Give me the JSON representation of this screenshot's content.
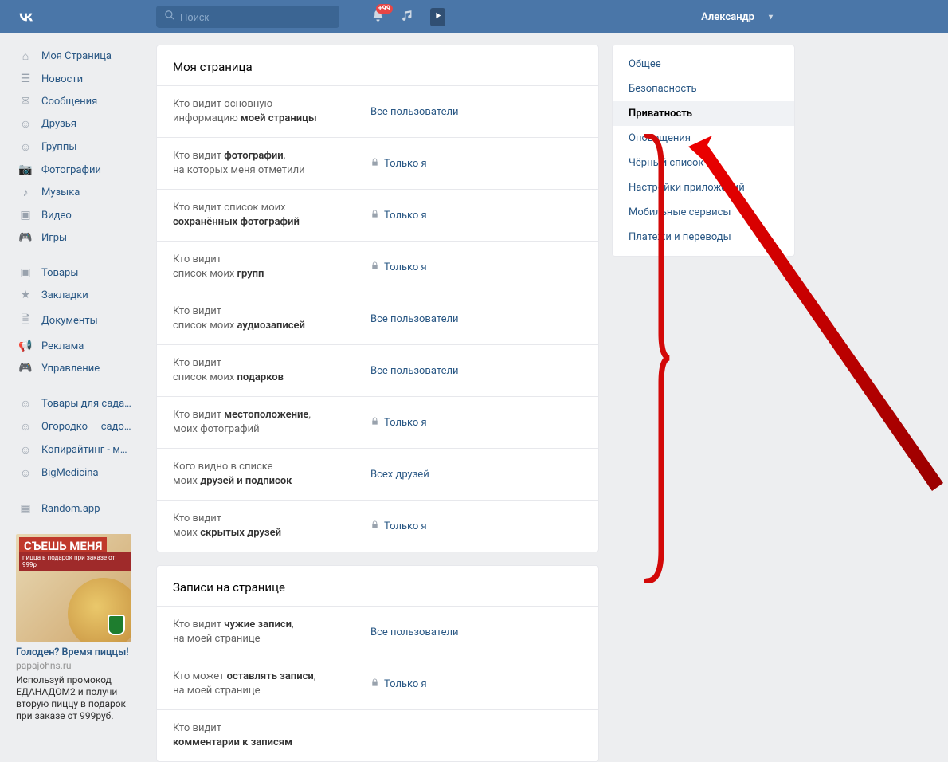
{
  "header": {
    "search_placeholder": "Поиск",
    "notif_badge": "+99",
    "username": "Александр"
  },
  "leftnav": {
    "items_a": [
      {
        "icon": "⌂",
        "label": "Моя Страница"
      },
      {
        "icon": "☰",
        "label": "Новости"
      },
      {
        "icon": "✉",
        "label": "Сообщения"
      },
      {
        "icon": "☺",
        "label": "Друзья"
      },
      {
        "icon": "☺",
        "label": "Группы"
      },
      {
        "icon": "📷",
        "label": "Фотографии"
      },
      {
        "icon": "♪",
        "label": "Музыка"
      },
      {
        "icon": "▣",
        "label": "Видео"
      },
      {
        "icon": "🎮",
        "label": "Игры"
      }
    ],
    "items_b": [
      {
        "icon": "▣",
        "label": "Товары"
      },
      {
        "icon": "★",
        "label": "Закладки"
      },
      {
        "icon": "🗎",
        "label": "Документы"
      },
      {
        "icon": "📢",
        "label": "Реклама"
      },
      {
        "icon": "🎮",
        "label": "Управление"
      }
    ],
    "items_c": [
      {
        "icon": "☺",
        "label": "Товары для сада…"
      },
      {
        "icon": "☺",
        "label": "Огородко — садо…"
      },
      {
        "icon": "☺",
        "label": "Копирайтинг - м…"
      },
      {
        "icon": "☺",
        "label": "BigMedicina"
      }
    ],
    "items_d": [
      {
        "icon": "▦",
        "label": "Random.app"
      }
    ]
  },
  "ad": {
    "red_label": "СЪЕШЬ МЕНЯ",
    "sub": "пицца в подарок при заказе от 999р",
    "title": "Голоден? Время пиццы!",
    "domain": "papajohns.ru",
    "desc": "Используй промокод ЕДАНАДОМ2 и получи вторую пиццу в подарок при заказе от 999руб."
  },
  "section1": {
    "title": "Моя страница",
    "rows": [
      {
        "l1": "Кто видит основную",
        "l2": "информацию ",
        "lb": "моей страницы",
        "value": "Все пользователи",
        "lock": false
      },
      {
        "l1": "Кто видит ",
        "lb1": "фотографии",
        "l2": "на которых меня отметили",
        "value": "Только я",
        "lock": true
      },
      {
        "l1": "Кто видит список моих",
        "l2": "",
        "lb": "сохранённых фотографий",
        "value": "Только я",
        "lock": true
      },
      {
        "l1": "Кто видит",
        "l2": "список моих ",
        "lb": "групп",
        "value": "Только я",
        "lock": true
      },
      {
        "l1": "Кто видит",
        "l2": "список моих ",
        "lb": "аудиозаписей",
        "value": "Все пользователи",
        "lock": false
      },
      {
        "l1": "Кто видит",
        "l2": "список моих ",
        "lb": "подарков",
        "value": "Все пользователи",
        "lock": false
      },
      {
        "l1": "Кто видит ",
        "lb1": "местоположение",
        "l2": "моих фотографий",
        "value": "Только я",
        "lock": true
      },
      {
        "l1": "Кого видно в списке",
        "l2": "моих ",
        "lb": "друзей и подписок",
        "value": "Всех друзей",
        "lock": false
      },
      {
        "l1": "Кто видит",
        "l2": "моих ",
        "lb": "скрытых друзей",
        "value": "Только я",
        "lock": true
      }
    ]
  },
  "section2": {
    "title": "Записи на странице",
    "rows": [
      {
        "l1": "Кто видит ",
        "lb1": "чужие записи",
        "l2": "на моей странице",
        "value": "Все пользователи",
        "lock": false
      },
      {
        "l1": "Кто может ",
        "lb1": "оставлять записи",
        "l2": "на моей странице",
        "value": "Только я",
        "lock": true
      },
      {
        "l1": "Кто видит",
        "l2": "",
        "lb": "комментарии к записям",
        "value": "",
        "lock": false
      }
    ]
  },
  "tabs": [
    {
      "label": "Общее",
      "active": false
    },
    {
      "label": "Безопасность",
      "active": false
    },
    {
      "label": "Приватность",
      "active": true
    },
    {
      "label": "Оповещения",
      "active": false
    },
    {
      "label": "Чёрный список",
      "active": false
    },
    {
      "label": "Настройки приложений",
      "active": false
    },
    {
      "label": "Мобильные сервисы",
      "active": false
    },
    {
      "label": "Платежи и переводы",
      "active": false
    }
  ]
}
